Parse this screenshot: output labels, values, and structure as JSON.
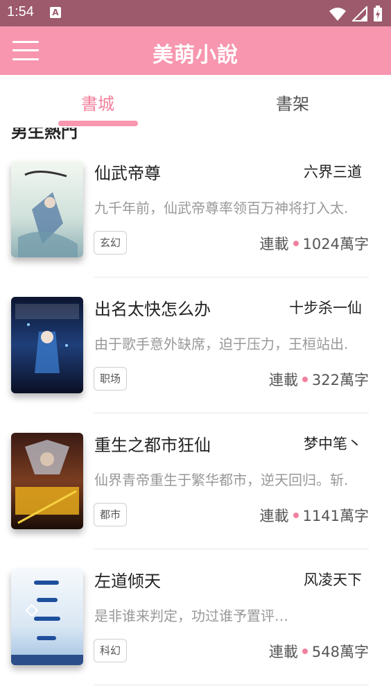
{
  "status": {
    "time": "1:54",
    "notification_glyph": "A"
  },
  "header": {
    "title": "美萌小說"
  },
  "tabs": [
    {
      "label": "書城",
      "active": true
    },
    {
      "label": "書架",
      "active": false
    }
  ],
  "section": {
    "title": "男生熱門"
  },
  "books": [
    {
      "title": "仙武帝尊",
      "author": "六界三道",
      "description": "九千年前，仙武帝尊率领百万神将打入太.",
      "tag": "玄幻",
      "status": "連載",
      "words": "1024萬字"
    },
    {
      "title": "出名太快怎么办",
      "author": "十步杀一仙",
      "description": "由于歌手意外缺席，迫于压力，王桓站出.",
      "tag": "职场",
      "status": "連載",
      "words": "322萬字"
    },
    {
      "title": "重生之都市狂仙",
      "author": "梦中笔丶",
      "description": "仙界青帝重生于繁华都市，逆天回归。斩.",
      "tag": "都市",
      "status": "連載",
      "words": "1141萬字"
    },
    {
      "title": "左道倾天",
      "author": "风凌天下",
      "description": "是非谁来判定，功过谁予置评…",
      "tag": "科幻",
      "status": "連載",
      "words": "548萬字"
    }
  ],
  "colors": {
    "accent": "#f796ae",
    "accent_text": "#f3819d",
    "status_bar": "#9c5a6c"
  }
}
